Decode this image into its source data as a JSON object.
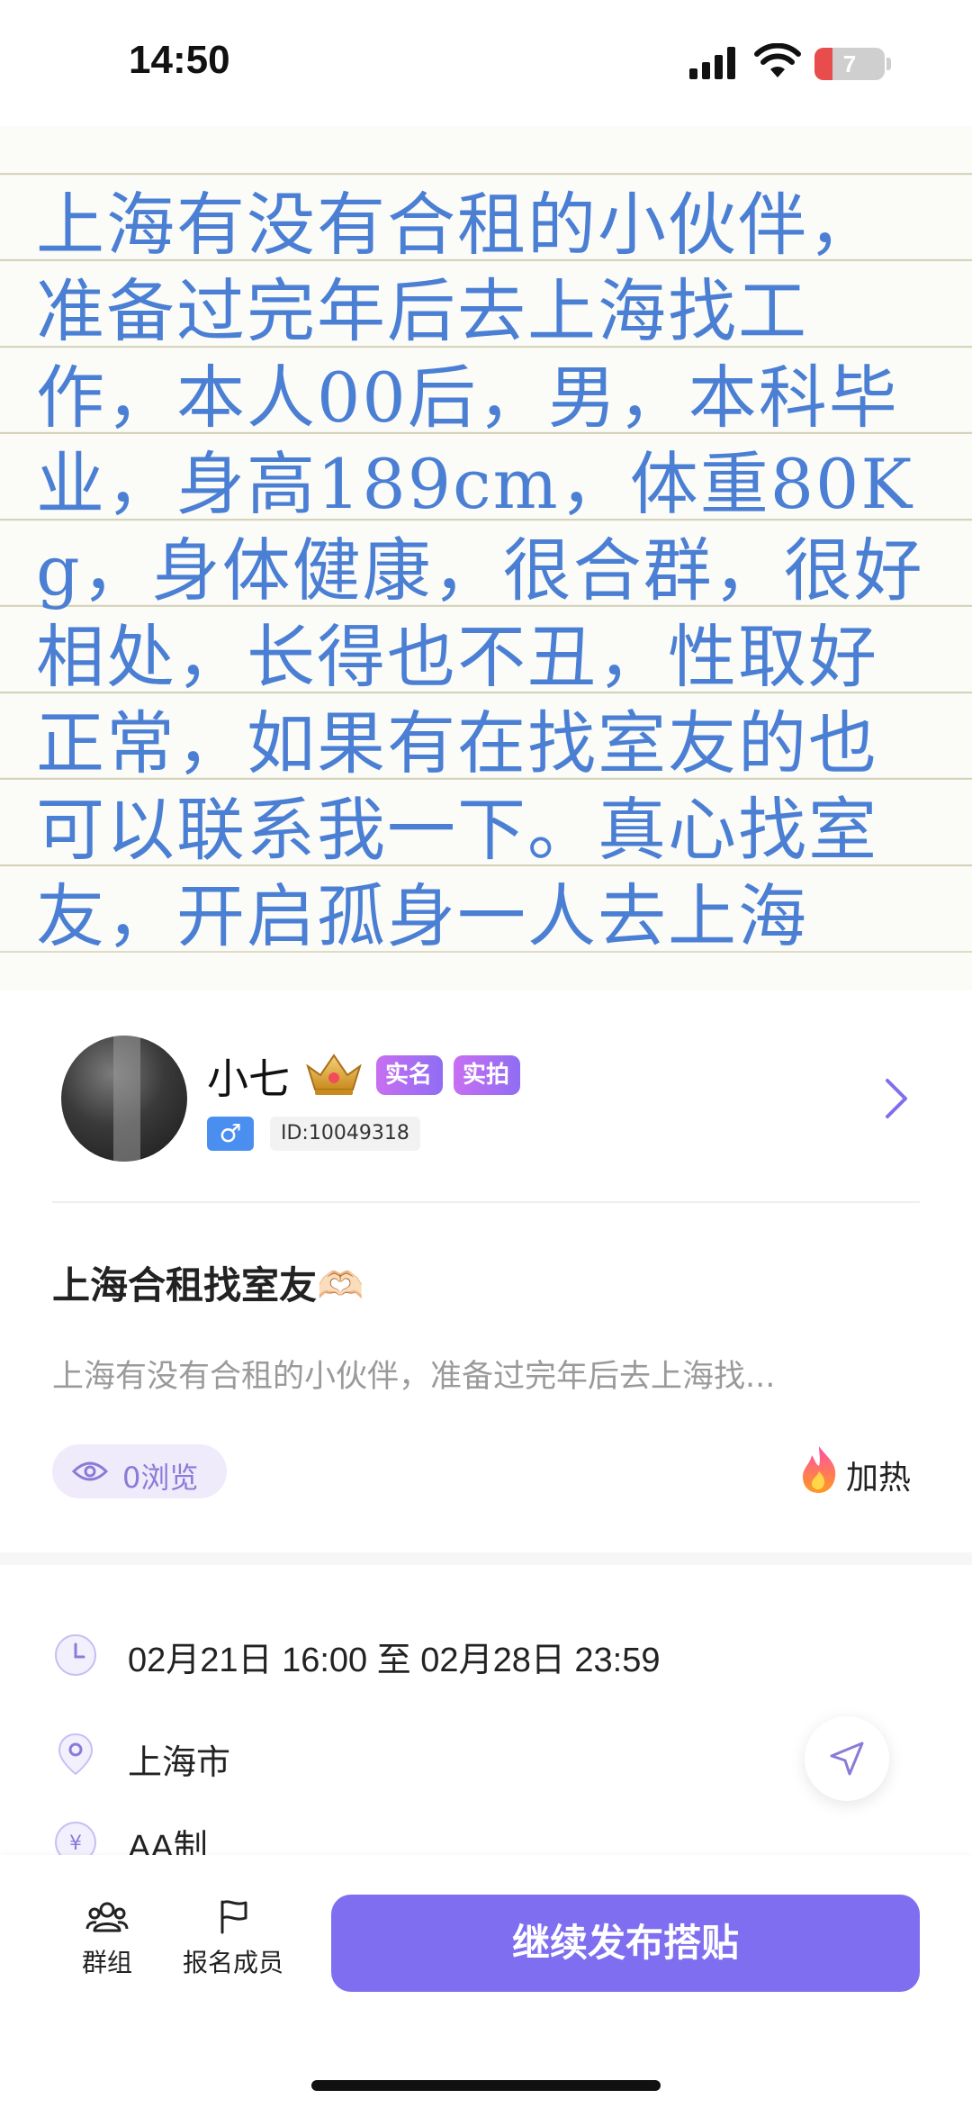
{
  "status_bar": {
    "time": "14:50",
    "battery": "7",
    "battery_fraction": 0.25
  },
  "hero": {
    "note_text": "上海有没有合租的小伙伴，准备过完年后去上海找工作，本人00后，男，本科毕业，身高189cm，体重80Kg，身体健康，很合群，很好相处，长得也不丑，性取好正常，如果有在找室友的也可以联系我一下。真心找室友，开启孤身一人去上海"
  },
  "user": {
    "name": "小七",
    "tags": [
      "实名",
      "实拍"
    ],
    "gender_symbol": "♂",
    "id_text": "ID:10049318"
  },
  "post": {
    "title": "上海合租找室友🫶🏻",
    "description": "上海有没有合租的小伙伴，准备过完年后去上海找...",
    "views_label": "0浏览",
    "heat_label": "加热"
  },
  "info": {
    "time_range": "02月21日 16:00 至 02月28日 23:59",
    "location": "上海市",
    "cost_partial": "AA制"
  },
  "bottom_bar": {
    "group_label": "群组",
    "members_label": "报名成员",
    "cta_label": "继续发布搭贴"
  },
  "colors": {
    "accent": "#7f6ef0",
    "note_ink": "#4a7fd4",
    "tag_gradient_start": "#c86ff2",
    "gender_blue": "#4a8ff0"
  }
}
